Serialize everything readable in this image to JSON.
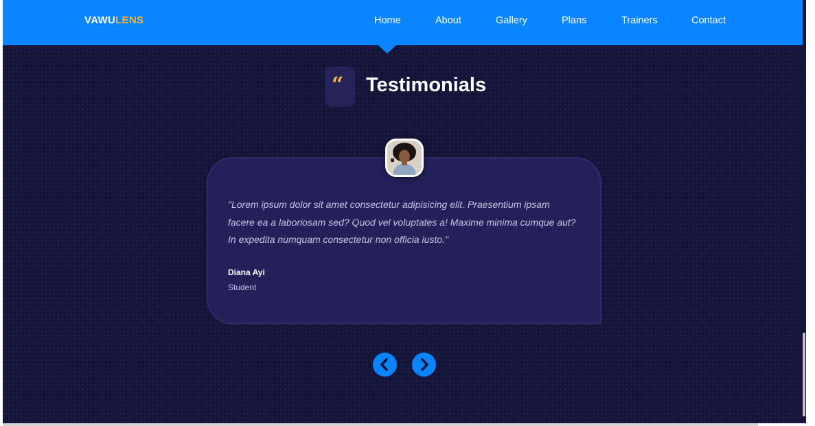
{
  "brand": {
    "part1": "VAWU",
    "part2": "LENS"
  },
  "nav": {
    "items": [
      {
        "label": "Home"
      },
      {
        "label": "About"
      },
      {
        "label": "Gallery"
      },
      {
        "label": "Plans"
      },
      {
        "label": "Trainers"
      },
      {
        "label": "Contact"
      }
    ]
  },
  "section": {
    "title": "Testimonials",
    "quote_icon": "quote-icon"
  },
  "testimonial": {
    "text": "\"Lorem ipsum dolor sit amet consectetur adipisicing elit. Praesentium ipsam facere ea a laboriosam sed? Quod vel voluptates a! Maxime minima cumque aut? In expedita numquam consectetur non officia iusto.\"",
    "author": "Diana Ayi",
    "role": "Student",
    "avatar_icon": "person-photo"
  },
  "controls": {
    "prev_icon": "chevron-left-icon",
    "next_icon": "chevron-right-icon"
  },
  "colors": {
    "accent": "#0a84ff",
    "brand_highlight": "#f5b731",
    "background": "#15143a",
    "card": "#23215a"
  }
}
